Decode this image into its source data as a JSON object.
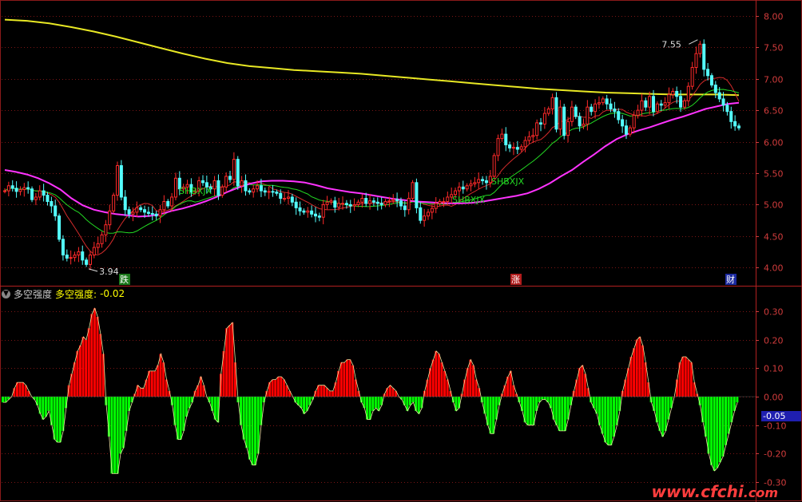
{
  "colors": {
    "background": "#000000",
    "up": "#ff2a2a",
    "down": "#54ffff",
    "ma_long": "#e8e824",
    "ma_mid": "#ff33ff",
    "ma_fast_red": "#d42b2b",
    "ma_fast_green": "#23d923",
    "indicator_pos": "#ff0000",
    "indicator_neg": "#00ff00",
    "grid": "#7a1515",
    "axis_text": "#d23c3c"
  },
  "indicator": {
    "collapse_icon": "chevron-down-icon",
    "name": "多空强度",
    "series_label": "多空强度:",
    "current_value": "-0.02",
    "current_badge": "-0.05"
  },
  "annotations": {
    "high_label": "7.55",
    "low_label": "3.94",
    "signal_1": "SHBXJX",
    "signal_2": "SHBXJX",
    "signal_3": "SHBXJX",
    "marker_down": "跌",
    "marker_up": "涨",
    "marker_fin": "财"
  },
  "watermark": {
    "main": "www.cfchi",
    "dom": ".com"
  },
  "chart_data": [
    {
      "type": "candlestick",
      "ylim": [
        3.75,
        8.15
      ],
      "y_ticks": [
        "8.00",
        "7.50",
        "7.00",
        "6.50",
        "6.00",
        "5.50",
        "5.00",
        "4.50",
        "4.00"
      ],
      "y_tick_values": [
        8.0,
        7.5,
        7.0,
        6.5,
        6.0,
        5.5,
        5.0,
        4.5,
        4.0
      ],
      "close": [
        5.22,
        5.3,
        5.26,
        5.21,
        5.24,
        5.27,
        5.25,
        5.08,
        5.12,
        5.22,
        5.15,
        5.05,
        4.98,
        4.82,
        4.45,
        4.2,
        4.15,
        4.16,
        4.2,
        4.25,
        4.12,
        4.05,
        4.2,
        4.32,
        4.38,
        4.52,
        4.68,
        4.9,
        5.15,
        5.62,
        5.12,
        4.92,
        4.85,
        4.88,
        4.95,
        4.92,
        4.88,
        4.86,
        4.85,
        4.82,
        4.92,
        5.05,
        4.98,
        5.12,
        5.42,
        5.25,
        5.28,
        5.32,
        5.2,
        5.22,
        5.38,
        5.35,
        5.28,
        5.25,
        5.38,
        5.15,
        5.28,
        5.45,
        5.4,
        5.72,
        5.3,
        5.38,
        5.22,
        5.2,
        5.25,
        5.3,
        5.22,
        5.2,
        5.21,
        5.2,
        5.18,
        5.1,
        5.1,
        5.12,
        5.04,
        4.95,
        4.9,
        4.88,
        4.9,
        4.85,
        4.82,
        4.8,
        5.0,
        5.04,
        5.06,
        4.96,
        5.02,
        5.02,
        5.0,
        4.98,
        5.0,
        5.04,
        5.1,
        5.02,
        5.06,
        5.04,
        5.02,
        5.0,
        5.05,
        5.06,
        5.08,
        5.06,
        4.98,
        4.92,
        5.1,
        5.35,
        4.95,
        4.75,
        4.82,
        4.88,
        4.94,
        5.02,
        5.05,
        5.05,
        5.12,
        5.16,
        5.22,
        5.28,
        5.25,
        5.3,
        5.33,
        5.35,
        5.4,
        5.38,
        5.35,
        5.45,
        5.78,
        6.05,
        6.12,
        5.95,
        5.9,
        5.91,
        5.88,
        5.92,
        6.02,
        6.08,
        6.1,
        6.3,
        6.28,
        6.45,
        6.52,
        6.7,
        6.2,
        6.55,
        6.1,
        6.32,
        6.55,
        6.4,
        6.25,
        6.28,
        6.55,
        6.48,
        6.6,
        6.62,
        6.68,
        6.6,
        6.52,
        6.48,
        6.35,
        6.25,
        6.12,
        6.22,
        6.42,
        6.5,
        6.65,
        6.55,
        6.72,
        6.48,
        6.6,
        6.58,
        6.62,
        6.75,
        6.8,
        6.72,
        6.55,
        6.65,
        6.88,
        7.18,
        7.4,
        7.55,
        7.15,
        7.05,
        6.9,
        6.78,
        6.68,
        6.58,
        6.48,
        6.32,
        6.25,
        6.22
      ],
      "ma_long": [
        7.94,
        7.92,
        7.88,
        7.82,
        7.75,
        7.67,
        7.58,
        7.49,
        7.4,
        7.32,
        7.25,
        7.2,
        7.17,
        7.14,
        7.12,
        7.1,
        7.08,
        7.05,
        7.02,
        6.99,
        6.96,
        6.93,
        6.9,
        6.87,
        6.84,
        6.82,
        6.8,
        6.78,
        6.77,
        6.76,
        6.75,
        6.75,
        6.75,
        6.74
      ],
      "ma_mid": [
        5.55,
        5.52,
        5.48,
        5.42,
        5.34,
        5.24,
        5.1,
        4.99,
        4.92,
        4.88,
        4.85,
        4.83,
        4.81,
        4.82,
        4.85,
        4.9,
        4.94,
        4.99,
        5.05,
        5.12,
        5.2,
        5.27,
        5.33,
        5.37,
        5.38,
        5.38,
        5.37,
        5.35,
        5.31,
        5.26,
        5.23,
        5.2,
        5.18,
        5.15,
        5.12,
        5.09,
        5.07,
        5.05,
        5.04,
        5.03,
        5.02,
        5.02,
        5.03,
        5.05,
        5.08,
        5.11,
        5.14,
        5.18,
        5.25,
        5.34,
        5.45,
        5.55,
        5.68,
        5.8,
        5.93,
        6.04,
        6.12,
        6.18,
        6.23,
        6.29,
        6.35,
        6.4,
        6.46,
        6.52,
        6.56,
        6.6,
        6.62
      ]
    },
    {
      "type": "bar",
      "name": "多空强度",
      "ylim": [
        -0.35,
        0.35
      ],
      "y_ticks": [
        "0.30",
        "0.20",
        "0.10",
        "0.00",
        "-0.10",
        "-0.20",
        "-0.30"
      ],
      "y_tick_values": [
        0.3,
        0.2,
        0.1,
        0.0,
        -0.1,
        -0.2,
        -0.3
      ],
      "values": [
        -0.02,
        -0.02,
        -0.01,
        0.0,
        0.03,
        0.05,
        0.05,
        0.05,
        0.04,
        0.02,
        0.0,
        -0.01,
        -0.03,
        -0.06,
        -0.08,
        -0.07,
        -0.05,
        -0.1,
        -0.15,
        -0.16,
        -0.16,
        -0.12,
        -0.04,
        0.04,
        0.08,
        0.12,
        0.16,
        0.18,
        0.21,
        0.2,
        0.24,
        0.29,
        0.31,
        0.28,
        0.22,
        0.15,
        -0.03,
        -0.14,
        -0.27,
        -0.27,
        -0.27,
        -0.2,
        -0.18,
        -0.12,
        -0.05,
        -0.02,
        0.01,
        0.04,
        0.03,
        0.03,
        0.06,
        0.09,
        0.09,
        0.09,
        0.11,
        0.15,
        0.12,
        0.06,
        0.02,
        -0.03,
        -0.1,
        -0.15,
        -0.15,
        -0.12,
        -0.07,
        -0.04,
        -0.02,
        0.02,
        0.04,
        0.07,
        0.04,
        0.0,
        -0.02,
        -0.05,
        -0.08,
        -0.09,
        0.08,
        0.16,
        0.24,
        0.25,
        0.26,
        0.12,
        -0.02,
        -0.1,
        -0.15,
        -0.18,
        -0.22,
        -0.24,
        -0.24,
        -0.2,
        -0.1,
        -0.02,
        0.02,
        0.05,
        0.06,
        0.06,
        0.07,
        0.07,
        0.06,
        0.04,
        0.02,
        0.0,
        -0.02,
        -0.03,
        -0.04,
        -0.06,
        -0.05,
        -0.03,
        -0.01,
        0.02,
        0.04,
        0.04,
        0.04,
        0.03,
        0.02,
        0.02,
        0.05,
        0.09,
        0.12,
        0.12,
        0.13,
        0.13,
        0.11,
        0.06,
        0.02,
        -0.02,
        -0.04,
        -0.08,
        -0.08,
        -0.05,
        -0.04,
        -0.05,
        -0.03,
        0.01,
        0.03,
        0.04,
        0.03,
        0.02,
        0.0,
        -0.01,
        -0.03,
        -0.05,
        -0.03,
        -0.02,
        -0.05,
        -0.06,
        -0.04,
        0.02,
        0.06,
        0.1,
        0.13,
        0.16,
        0.15,
        0.12,
        0.09,
        0.06,
        0.02,
        -0.02,
        -0.05,
        -0.04,
        0.01,
        0.06,
        0.1,
        0.13,
        0.11,
        0.06,
        0.03,
        -0.02,
        -0.06,
        -0.1,
        -0.13,
        -0.13,
        -0.08,
        -0.03,
        0.01,
        0.04,
        0.07,
        0.09,
        0.04,
        0.01,
        -0.02,
        -0.05,
        -0.09,
        -0.1,
        -0.1,
        -0.1,
        -0.05,
        -0.02,
        -0.01,
        -0.01,
        -0.02,
        -0.04,
        -0.08,
        -0.1,
        -0.12,
        -0.12,
        -0.12,
        -0.08,
        -0.03,
        0.02,
        0.06,
        0.1,
        0.11,
        0.08,
        0.03,
        -0.02,
        -0.04,
        -0.06,
        -0.1,
        -0.13,
        -0.16,
        -0.17,
        -0.17,
        -0.14,
        -0.1,
        -0.05,
        0.02,
        0.06,
        0.1,
        0.14,
        0.17,
        0.2,
        0.21,
        0.18,
        0.12,
        0.05,
        -0.02,
        -0.05,
        -0.09,
        -0.12,
        -0.14,
        -0.12,
        -0.08,
        -0.04,
        0.0,
        0.06,
        0.12,
        0.14,
        0.14,
        0.13,
        0.12,
        0.05,
        0.01,
        -0.03,
        -0.09,
        -0.14,
        -0.2,
        -0.24,
        -0.26,
        -0.25,
        -0.23,
        -0.21,
        -0.17,
        -0.13,
        -0.09,
        -0.05,
        -0.02
      ]
    }
  ]
}
